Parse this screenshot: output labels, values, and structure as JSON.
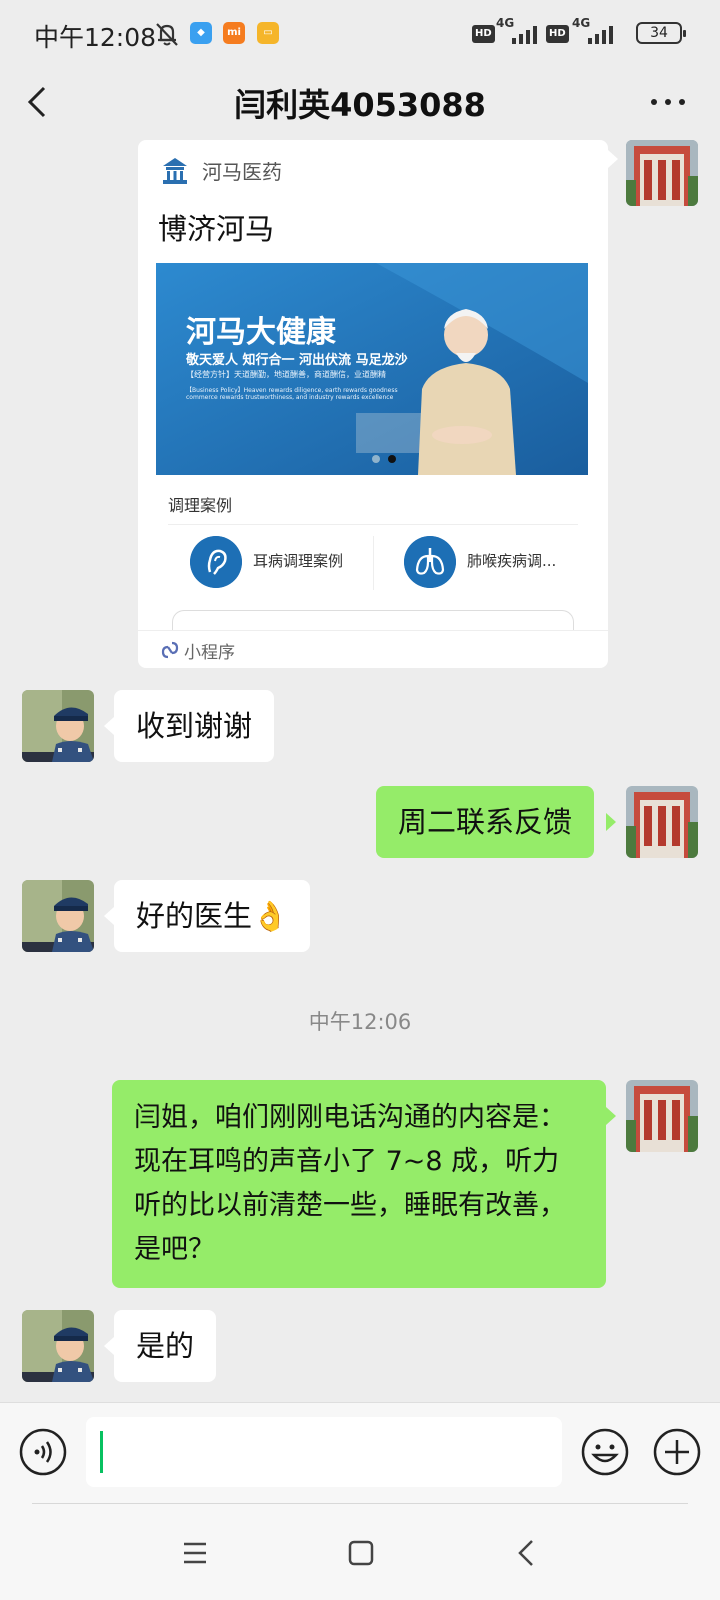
{
  "status_bar": {
    "time": "中午12:08",
    "network_1": "4G",
    "network_2": "4G",
    "hd_1": "HD",
    "hd_2": "HD",
    "battery": "34",
    "mi_app": "mi",
    "icons": [
      "mute-bell-icon",
      "app-blue-icon",
      "app-mi-icon",
      "app-yellow-icon",
      "signal-icon",
      "battery-icon"
    ]
  },
  "header": {
    "title": "闫利英4053088",
    "back_icon": "chevron-left-icon",
    "more_icon": "more-dots-icon"
  },
  "mini_program_card": {
    "source": "河马医药",
    "title": "博济河马",
    "banner": {
      "headline": "河马大健康",
      "slogan": "敬天爱人 知行合一 河出伏流 马足龙沙",
      "policy_cn": "【经营方针】天道酬勤，地道酬善，商道酬信，业道酬精",
      "policy_en_1": "【Business Policy】Heaven rewards diligence, earth rewards goodness",
      "policy_en_2": "commerce rewards trustworthiness, and industry rewards excellence"
    },
    "section_label": "调理案例",
    "cases": [
      {
        "label": "耳病调理案例",
        "icon": "ear-icon"
      },
      {
        "label": "肺喉疾病调...",
        "icon": "lungs-icon"
      }
    ],
    "footer_label": "小程序",
    "footer_icon": "mini-program-link-icon"
  },
  "messages": [
    {
      "side": "in",
      "text": "收到谢谢"
    },
    {
      "side": "out",
      "text": "周二联系反馈"
    },
    {
      "side": "in",
      "text": "好的医生👌"
    },
    {
      "side": "out",
      "lines": [
        "闫姐，咱们刚刚电话沟通的内容是：",
        "现在耳鸣的声音小了 7~8 成，听力",
        "听的比以前清楚一些，睡眠有改善，",
        "是吧？"
      ]
    },
    {
      "side": "in",
      "text": "是的"
    }
  ],
  "timestamp": "中午12:06",
  "input_bar": {
    "voice_icon": "voice-icon",
    "emoji_icon": "emoji-icon",
    "plus_icon": "plus-icon",
    "value": ""
  },
  "system_nav": [
    "menu-icon",
    "home-icon",
    "back-triangle-icon"
  ],
  "colors": {
    "background": "#ededed",
    "outgoing_bubble": "#95ec69",
    "incoming_bubble": "#ffffff",
    "caret": "#07c160",
    "banner_blue": "#2a86c8"
  }
}
